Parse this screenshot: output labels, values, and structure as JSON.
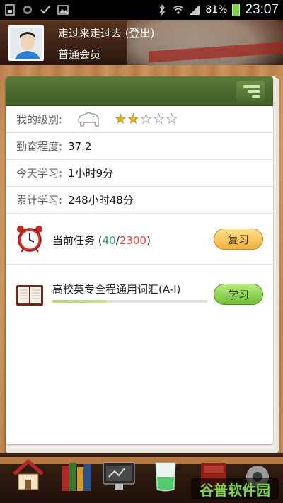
{
  "status_bar": {
    "battery": "81%",
    "time": "23:07",
    "icons": [
      "sim-icon",
      "sync-icon",
      "check-icon",
      "gallery-icon",
      "bluetooth-icon",
      "wifi-icon",
      "signal-icon",
      "battery-icon"
    ]
  },
  "header": {
    "username": "走过来走过去 (登出)",
    "member_type": "普通会员"
  },
  "profile": {
    "level_label": "我的级别:",
    "level_stars": 2,
    "level_stars_max": 5,
    "diligence_label": "勤奋程度:",
    "diligence_value": "37.2",
    "today_label": "今天学习:",
    "today_value": "1小时9分",
    "total_label": "累计学习:",
    "total_value": "248小时48分"
  },
  "task": {
    "label": "当前任务 (",
    "done": "40",
    "sep": "/",
    "total": "2300",
    "close": ")",
    "review_button": "复习"
  },
  "book": {
    "title": "高校英专全程通用词汇(A-I)",
    "progress": 0.35,
    "study_button": "学习"
  },
  "watermark": "谷普软件园",
  "colors": {
    "header_green": "#4a6a2c",
    "star": "#e9b018",
    "task_done": "#2b9d7a",
    "task_total": "#d9463a"
  }
}
